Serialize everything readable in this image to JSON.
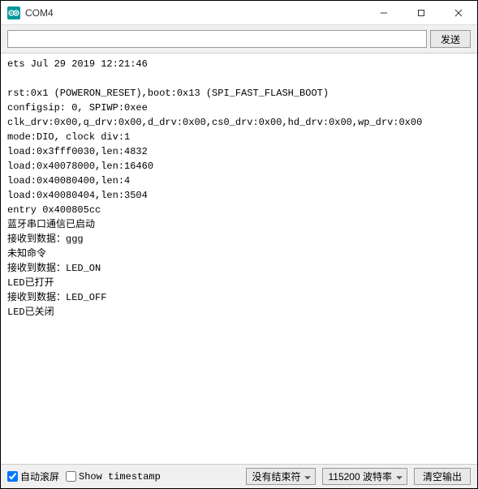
{
  "titlebar": {
    "title": "COM4"
  },
  "inputRow": {
    "value": "",
    "sendLabel": "发送"
  },
  "output": "ets Jul 29 2019 12:21:46\n\nrst:0x1 (POWERON_RESET),boot:0x13 (SPI_FAST_FLASH_BOOT)\nconfigsip: 0, SPIWP:0xee\nclk_drv:0x00,q_drv:0x00,d_drv:0x00,cs0_drv:0x00,hd_drv:0x00,wp_drv:0x00\nmode:DIO, clock div:1\nload:0x3fff0030,len:4832\nload:0x40078000,len:16460\nload:0x40080400,len:4\nload:0x40080404,len:3504\nentry 0x400805cc\n蓝牙串口通信已启动\n接收到数据：ggg\n未知命令\n接收到数据：LED_ON\nLED已打开\n接收到数据：LED_OFF\nLED已关闭",
  "bottomBar": {
    "autoscrollLabel": "自动滚屏",
    "autoscrollChecked": true,
    "timestampLabel": "Show timestamp",
    "timestampChecked": false,
    "lineEndingSelected": "没有结束符",
    "baudSelected": "115200 波特率",
    "clearLabel": "清空输出"
  }
}
